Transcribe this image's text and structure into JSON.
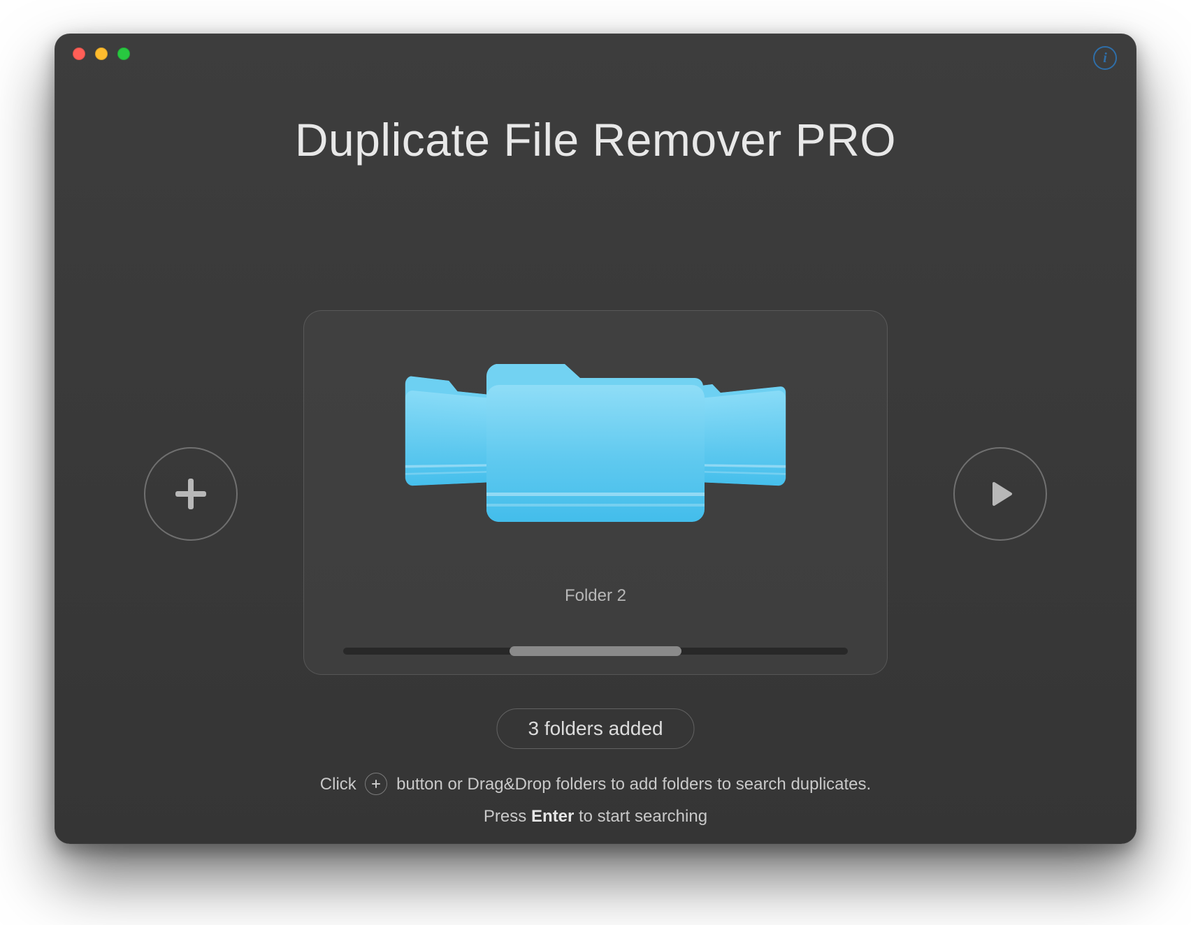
{
  "app": {
    "title": "Duplicate File Remover PRO"
  },
  "coverflow": {
    "selected_label": "Folder 2"
  },
  "status": {
    "pill": "3 folders added"
  },
  "hint": {
    "line1_pre": "Click ",
    "line1_post": " button or Drag&Drop folders to add folders to search duplicates.",
    "line2_pre": "Press ",
    "line2_bold": "Enter",
    "line2_post": " to start searching"
  },
  "icons": {
    "info": "i",
    "plus": "plus-icon",
    "play": "play-icon"
  },
  "colors": {
    "traffic_red": "#ff5f57",
    "traffic_yellow": "#febc2e",
    "traffic_green": "#28c840",
    "info_ring": "#2f6ea8",
    "folder_top": "#7fd7f5",
    "folder_mid": "#5fc9ef"
  }
}
